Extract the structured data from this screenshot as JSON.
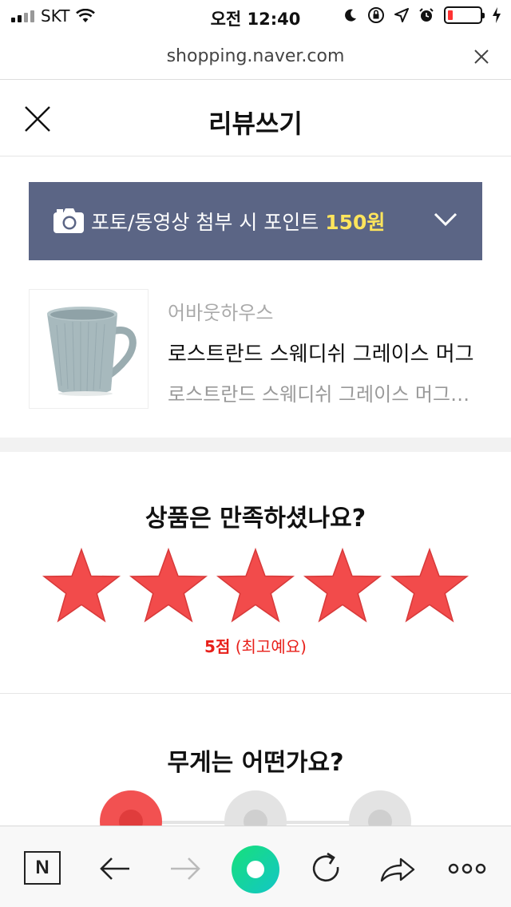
{
  "status_bar": {
    "carrier": "SKT",
    "time": "오전 12:40"
  },
  "browser": {
    "url": "shopping.naver.com"
  },
  "header": {
    "title": "리뷰쓰기"
  },
  "point_banner": {
    "text": "포토/동영상 첨부 시 포인트 ",
    "amount": "150원"
  },
  "product": {
    "brand": "어바웃하우스",
    "name": "로스트란드 스웨디쉬 그레이스 머그",
    "option": "로스트란드 스웨디쉬 그레이스 머그컵 라이트블루"
  },
  "rating": {
    "question": "상품은 만족하셨나요?",
    "stars_filled": 5,
    "stars_total": 5,
    "star_color": "#f24b4b",
    "score_label": "5점",
    "score_desc": "(최고예요)"
  },
  "weight": {
    "question": "무게는 어떤가요?",
    "selected_index": 0,
    "options_count": 3
  },
  "colors": {
    "banner_bg": "#5b6585",
    "banner_accent": "#ffe55c",
    "accent_red": "#e8201a"
  },
  "toolbar": {
    "home_label": "N"
  }
}
